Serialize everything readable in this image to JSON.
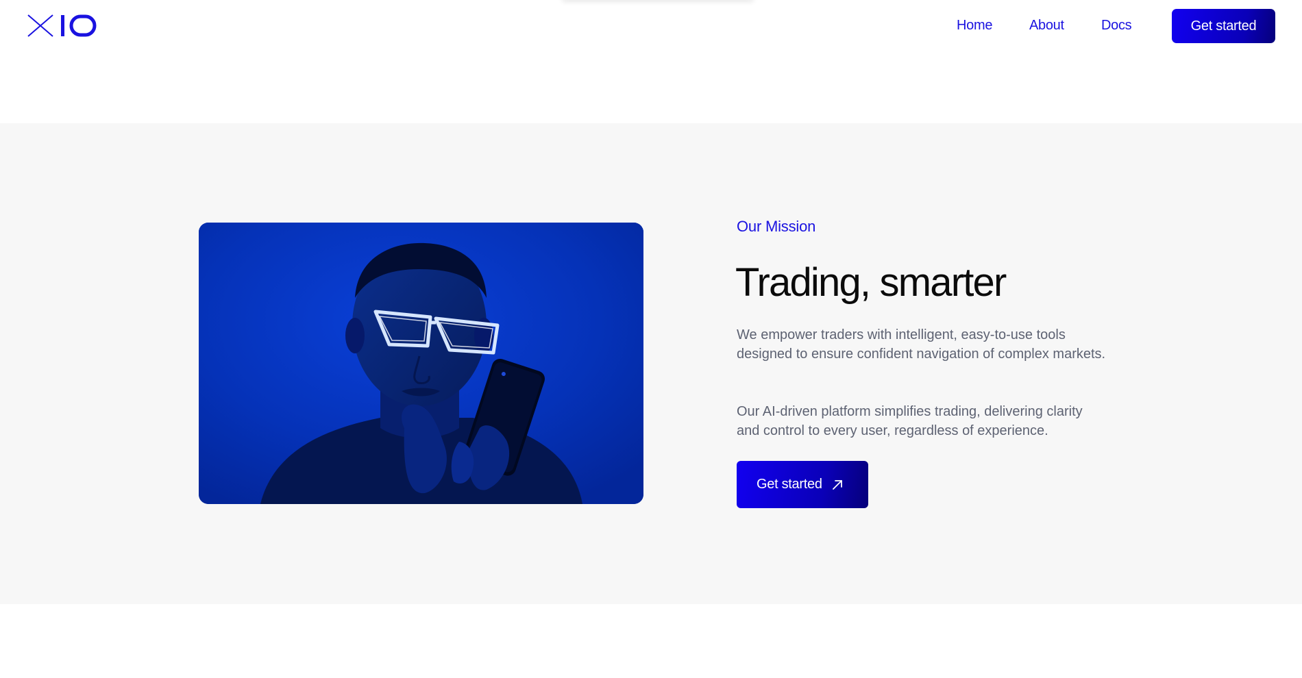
{
  "header": {
    "logo_alt": "XIO",
    "nav": [
      {
        "label": "Home"
      },
      {
        "label": "About"
      },
      {
        "label": "Docs"
      }
    ],
    "cta_label": "Get started"
  },
  "mission": {
    "eyebrow": "Our Mission",
    "headline": "Trading, smarter",
    "paragraphs": [
      "We empower traders with intelligent, easy-to-use tools designed to ensure confident navigation of complex markets.",
      "Our AI-driven platform simplifies trading, delivering clarity and control to every user, regardless of experience."
    ],
    "cta_label": "Get started",
    "cta_icon": "arrow-up-right-icon",
    "image_subject": "person-with-glasses-looking-at-phone"
  },
  "colors": {
    "accent": "#1a12e0",
    "button_gradient_start": "#1200f0",
    "button_gradient_end": "#06007a",
    "section_background": "#f7f7f7",
    "body_text": "#5d6272",
    "heading_text": "#0b0b0b"
  }
}
